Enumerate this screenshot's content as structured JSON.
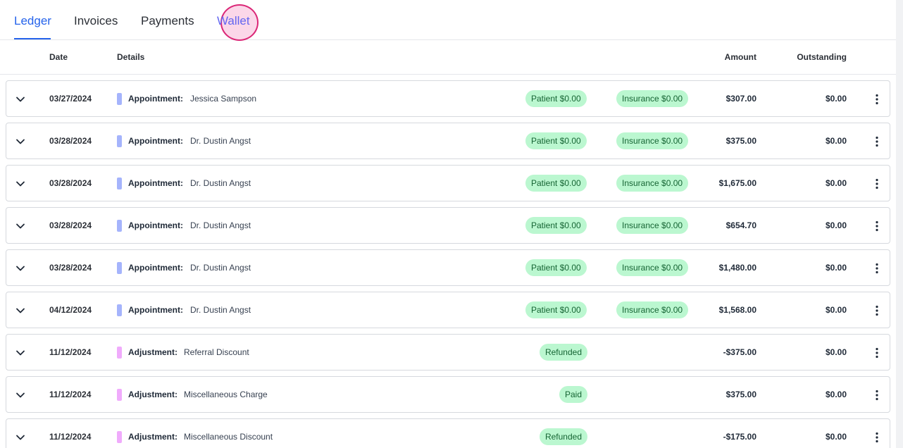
{
  "tabs": [
    {
      "label": "Ledger"
    },
    {
      "label": "Invoices"
    },
    {
      "label": "Payments"
    },
    {
      "label": "Wallet"
    }
  ],
  "columns": {
    "date": "Date",
    "details": "Details",
    "amount": "Amount",
    "outstanding": "Outstanding"
  },
  "colors": {
    "accent": "#2563eb",
    "appointment_marker": "#a5b4fc",
    "adjustment_marker": "#f0abfc",
    "pill_bg": "#bbf7d0",
    "pill_text": "#166534"
  },
  "icons": {
    "expand": "chevron-down-icon",
    "menu": "kebab-vertical-icon"
  },
  "rows": [
    {
      "date": "03/27/2024",
      "type": "Appointment:",
      "kind": "appointment",
      "detail": "Jessica Sampson",
      "patient": "Patient $0.00",
      "insurance": "Insurance $0.00",
      "amount": "$307.00",
      "outstanding": "$0.00"
    },
    {
      "date": "03/28/2024",
      "type": "Appointment:",
      "kind": "appointment",
      "detail": "Dr. Dustin Angst",
      "patient": "Patient $0.00",
      "insurance": "Insurance $0.00",
      "amount": "$375.00",
      "outstanding": "$0.00"
    },
    {
      "date": "03/28/2024",
      "type": "Appointment:",
      "kind": "appointment",
      "detail": "Dr. Dustin Angst",
      "patient": "Patient $0.00",
      "insurance": "Insurance $0.00",
      "amount": "$1,675.00",
      "outstanding": "$0.00"
    },
    {
      "date": "03/28/2024",
      "type": "Appointment:",
      "kind": "appointment",
      "detail": "Dr. Dustin Angst",
      "patient": "Patient $0.00",
      "insurance": "Insurance $0.00",
      "amount": "$654.70",
      "outstanding": "$0.00"
    },
    {
      "date": "03/28/2024",
      "type": "Appointment:",
      "kind": "appointment",
      "detail": "Dr. Dustin Angst",
      "patient": "Patient $0.00",
      "insurance": "Insurance $0.00",
      "amount": "$1,480.00",
      "outstanding": "$0.00"
    },
    {
      "date": "04/12/2024",
      "type": "Appointment:",
      "kind": "appointment",
      "detail": "Dr. Dustin Angst",
      "patient": "Patient $0.00",
      "insurance": "Insurance $0.00",
      "amount": "$1,568.00",
      "outstanding": "$0.00"
    },
    {
      "date": "11/12/2024",
      "type": "Adjustment:",
      "kind": "adjustment",
      "detail": "Referral Discount",
      "status": "Refunded",
      "amount": "-$375.00",
      "outstanding": "$0.00"
    },
    {
      "date": "11/12/2024",
      "type": "Adjustment:",
      "kind": "adjustment",
      "detail": "Miscellaneous Charge",
      "status": "Paid",
      "amount": "$375.00",
      "outstanding": "$0.00"
    },
    {
      "date": "11/12/2024",
      "type": "Adjustment:",
      "kind": "adjustment",
      "detail": "Miscellaneous Discount",
      "status": "Refunded",
      "amount": "-$175.00",
      "outstanding": "$0.00"
    }
  ]
}
